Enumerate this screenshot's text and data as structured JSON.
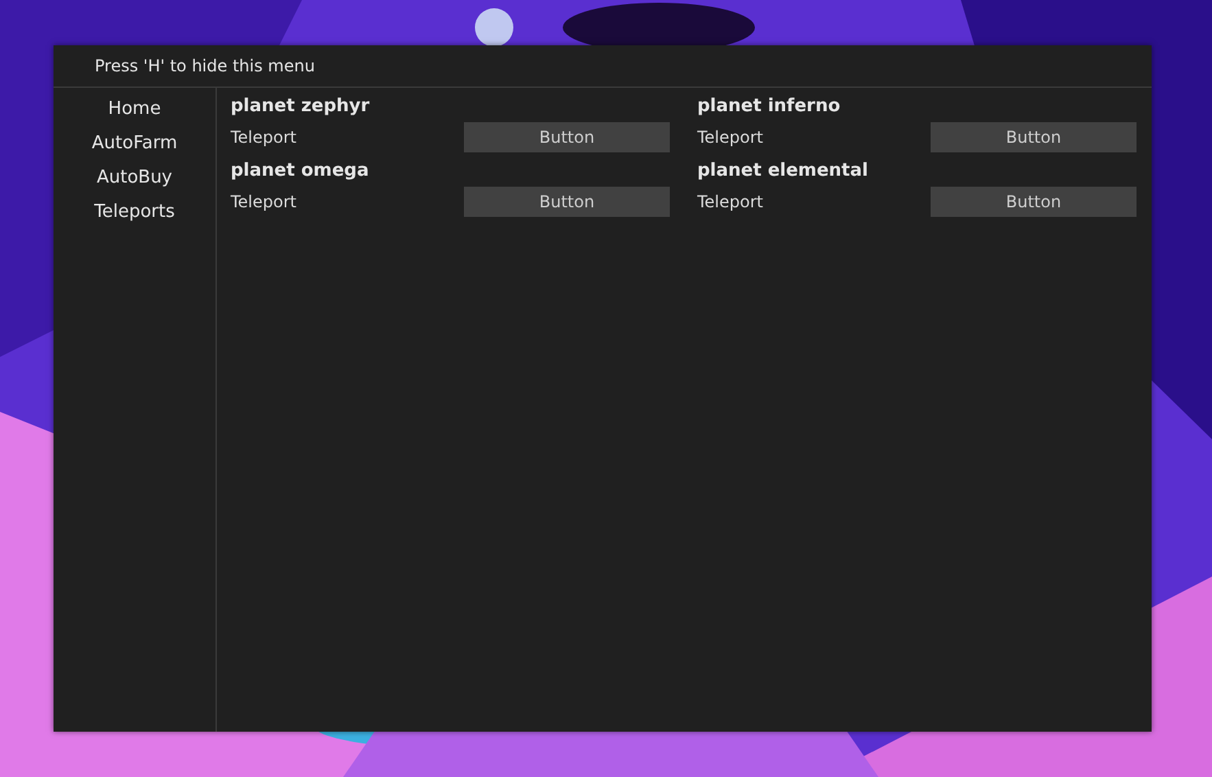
{
  "window": {
    "title": "Press 'H' to hide this menu"
  },
  "sidebar": {
    "items": [
      {
        "label": "Home"
      },
      {
        "label": "AutoFarm"
      },
      {
        "label": "AutoBuy"
      },
      {
        "label": "Teleports"
      }
    ]
  },
  "sections": [
    {
      "title": "planet zephyr",
      "label": "Teleport",
      "button": "Button"
    },
    {
      "title": "planet inferno",
      "label": "Teleport",
      "button": "Button"
    },
    {
      "title": "planet omega",
      "label": "Teleport",
      "button": "Button"
    },
    {
      "title": "planet elemental",
      "label": "Teleport",
      "button": "Button"
    }
  ]
}
